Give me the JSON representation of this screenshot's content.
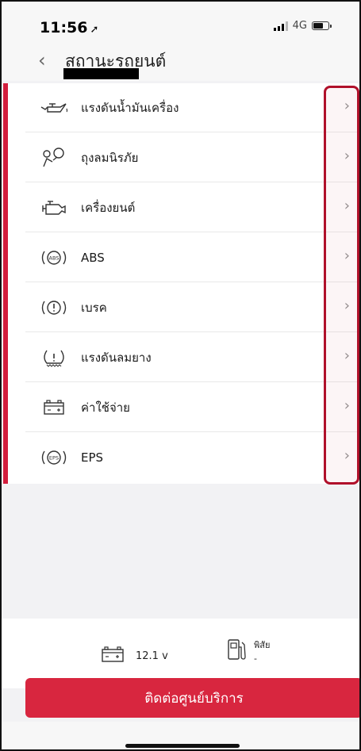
{
  "status_bar": {
    "time": "11:56",
    "location_arrow": "➚",
    "network": "4G",
    "icons": [
      "signal-icon",
      "battery-icon"
    ]
  },
  "header": {
    "back_icon": "chevron-left-icon",
    "title": "สถานะรถยนต์"
  },
  "list": {
    "accent_color": "#d21d3c",
    "items": [
      {
        "label": "แรงดันน้ำมันเครื่อง",
        "icon": "oil-pressure-icon"
      },
      {
        "label": "ถุงลมนิรภัย",
        "icon": "airbag-icon"
      },
      {
        "label": "เครื่องยนต์",
        "icon": "engine-icon"
      },
      {
        "label": "ABS",
        "icon": "abs-icon"
      },
      {
        "label": "เบรค",
        "icon": "brake-icon"
      },
      {
        "label": "แรงดันลมยาง",
        "icon": "tire-pressure-icon"
      },
      {
        "label": "ค่าใช้จ่าย",
        "icon": "battery-expense-icon"
      },
      {
        "label": "EPS",
        "icon": "eps-icon"
      }
    ]
  },
  "info": {
    "voltage": "12.1 v",
    "range_label": "พิสัย",
    "range_value": "-"
  },
  "contact_button": {
    "label": "ติดต่อศูนย์บริการ",
    "color": "#d8263f"
  }
}
